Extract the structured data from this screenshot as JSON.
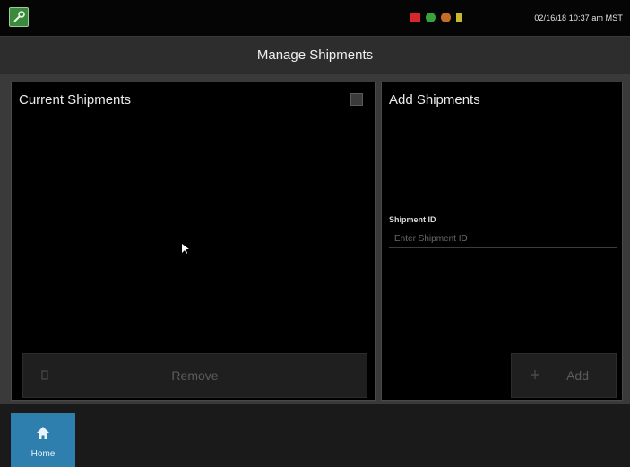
{
  "status_bar": {
    "app_icon": "wrench-icon",
    "status_icons": [
      "alert-icon",
      "gps-icon",
      "network-icon",
      "signal-icon"
    ],
    "datetime": "02/16/18 10:37 am MST"
  },
  "header": {
    "title": "Manage Shipments"
  },
  "current_shipments": {
    "title": "Current Shipments",
    "select_all_checkbox": "checkbox-icon",
    "remove_label": "Remove",
    "remove_icon": "remove-icon"
  },
  "add_shipments": {
    "title": "Add Shipments",
    "field_label": "Shipment ID",
    "field_placeholder": "Enter Shipment ID",
    "field_value": "",
    "add_label": "Add",
    "add_icon": "plus-icon"
  },
  "bottom_nav": {
    "home_label": "Home",
    "home_icon": "home-icon"
  },
  "colors": {
    "accent": "#2f7fae",
    "header_bg": "#2d2d2d",
    "panel_bg": "#000000",
    "disabled_button": "#1f1f1f"
  }
}
